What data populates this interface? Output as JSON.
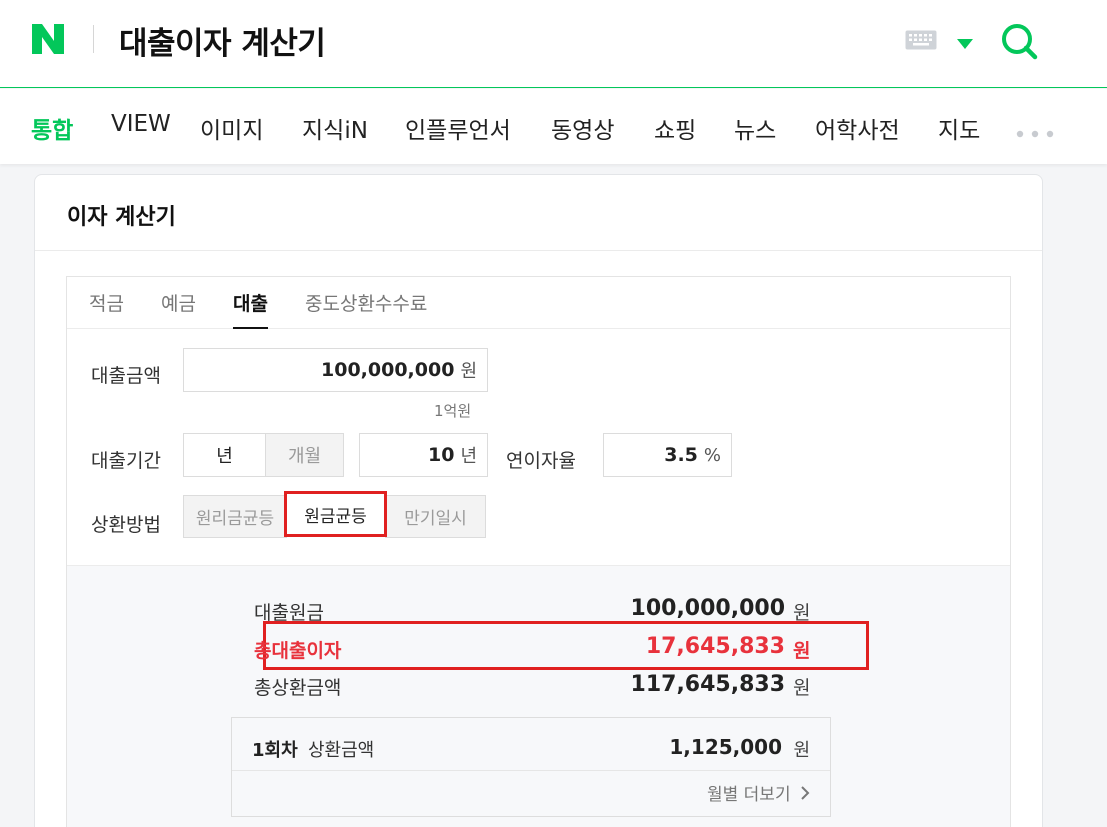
{
  "header": {
    "title": "대출이자 계산기",
    "logo_letter": "N",
    "brand_color": "#03c75a"
  },
  "nav": {
    "items": [
      "통합",
      "VIEW",
      "이미지",
      "지식iN",
      "인플루언서",
      "동영상",
      "쇼핑",
      "뉴스",
      "어학사전",
      "지도"
    ],
    "active_index": 0,
    "more_icon": "more-dots-icon"
  },
  "card": {
    "title": "이자 계산기",
    "tabs": [
      "적금",
      "예금",
      "대출",
      "중도상환수수료"
    ],
    "active_tab": "대출",
    "loan_amount": {
      "label": "대출금액",
      "value": "100,000,000",
      "unit": "원",
      "note": "1억원"
    },
    "loan_period": {
      "label": "대출기간",
      "unit_options": [
        "년",
        "개월"
      ],
      "selected_unit": "년",
      "value": "10",
      "unit": "년"
    },
    "interest_rate": {
      "label": "연이자율",
      "value": "3.5",
      "unit": "%"
    },
    "repayment": {
      "label": "상환방법",
      "options": [
        "원리금균등",
        "원금균등",
        "만기일시"
      ],
      "selected": "원금균등"
    },
    "results": {
      "principal": {
        "label": "대출원금",
        "value": "100,000,000",
        "unit": "원"
      },
      "total_interest": {
        "label": "총대출이자",
        "value": "17,645,833",
        "unit": "원"
      },
      "total_repayment": {
        "label": "총상환금액",
        "value": "117,645,833",
        "unit": "원"
      }
    },
    "installment": {
      "round_label": "1회차",
      "label": "상환금액",
      "value": "1,125,000",
      "unit": "원",
      "more_label": "월별 더보기",
      "more_icon": "chevron-right-icon"
    }
  },
  "colors": {
    "accent": "#03c75a",
    "highlight_red": "#e02020",
    "interest_red": "#e8323c"
  }
}
